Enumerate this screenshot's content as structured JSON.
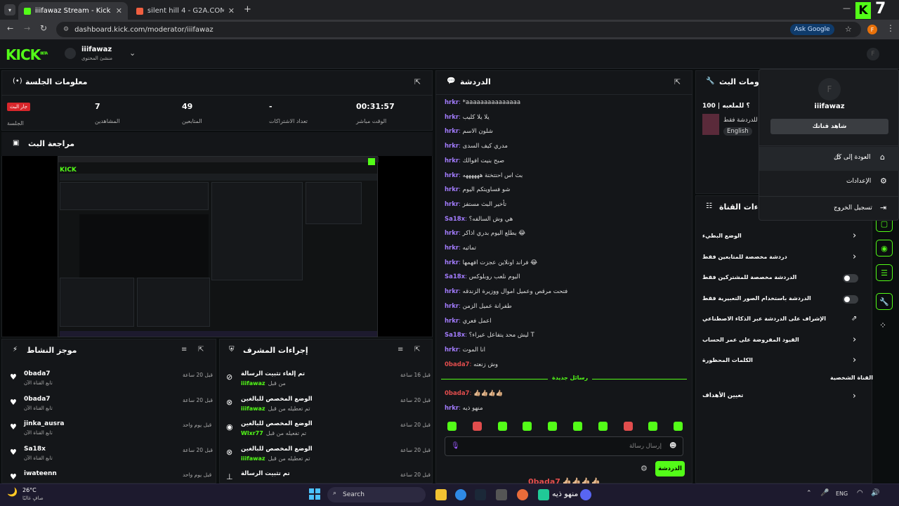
{
  "browser": {
    "tabs": [
      {
        "title": "iiifawaz Stream - Kick Dashboard",
        "active": true
      },
      {
        "title": "silent hill 4 - G2A.COM",
        "active": false
      }
    ],
    "url": "dashboard.kick.com/moderator/iiifawaz",
    "ask_label": "Ask Google",
    "profile_initial": "F"
  },
  "header": {
    "logo": "KICK",
    "logo_tag": "BETA",
    "channel_name": "iiifawaz",
    "channel_role": "منشئ المحتوى",
    "corner_logo": "K 7"
  },
  "session": {
    "title": "معلومات الجلسة",
    "live_badge": "جار البث",
    "session_label": "الجلسة",
    "stats": [
      {
        "value": "00:31:57",
        "label": "الوقت مباشر"
      },
      {
        "value": "-",
        "label": "تعداد الاشتراكات"
      },
      {
        "value": "49",
        "label": "المتابعين"
      },
      {
        "value": "7",
        "label": "المشاهدين"
      }
    ]
  },
  "preview": {
    "title": "مراجعة البث"
  },
  "chat": {
    "title": "الدردشة",
    "messages": [
      {
        "user": "hrkr",
        "text": "*aaaaaaaaaaaaaaa",
        "color": "#a37cff"
      },
      {
        "user": "hrkr",
        "text": "يلا يلا كليب",
        "color": "#a37cff"
      },
      {
        "user": "hrkr",
        "text": "شلون الاسم",
        "color": "#a37cff"
      },
      {
        "user": "hrkr",
        "text": "مدري كيف السدى",
        "color": "#a37cff"
      },
      {
        "user": "hrkr",
        "text": "صبح بنيت افوالك",
        "color": "#a37cff"
      },
      {
        "user": "hrkr",
        "text": "بث اس احتتختة ههههههه",
        "color": "#a37cff"
      },
      {
        "user": "hrkr",
        "text": "شو فساويتكم اليوم",
        "color": "#a37cff"
      },
      {
        "user": "hrkr",
        "text": "تأخير البث مستفز",
        "color": "#a37cff"
      },
      {
        "user": "Sa18x",
        "text": "هي وش السالفه؟",
        "color": "#a37cff"
      },
      {
        "user": "hrkr",
        "text": "يطلع اليوم بدري اذاكر 😂",
        "color": "#a37cff"
      },
      {
        "user": "hrkr",
        "text": "تماثيه",
        "color": "#a37cff"
      },
      {
        "user": "hrkr",
        "text": "فراند اونلاين عجزت افهمها 😂",
        "color": "#a37cff"
      },
      {
        "user": "Sa18x",
        "text": "اليوم نلعب روبلوكس",
        "color": "#a37cff"
      },
      {
        "user": "hrkr",
        "text": "فتحت مرقص وعميل اموال ووزيرة الزندقه",
        "color": "#a37cff"
      },
      {
        "user": "hrkr",
        "text": "طفرانة عميل الزمن",
        "color": "#a37cff"
      },
      {
        "user": "hrkr",
        "text": "اعمل فعري",
        "color": "#a37cff"
      },
      {
        "user": "Sa18x",
        "text": "ليش محد يتفاعل عيراء؟ T",
        "color": "#a37cff"
      },
      {
        "user": "hrkr",
        "text": "انا الموت",
        "color": "#a37cff"
      },
      {
        "user": "0bada7",
        "text": "وش زنعته",
        "color": "#e14d4d"
      }
    ],
    "new_messages": "رسائل جديدة",
    "after": [
      {
        "user": "0bada7",
        "text": "👍🏼👍🏼👍🏼👍🏼",
        "color": "#e14d4d"
      },
      {
        "user": "hrkr",
        "text": "منهو ذيه",
        "color": "#a37cff"
      }
    ],
    "input_placeholder": "إرسال رسالة",
    "send_label": "الدردشة",
    "overlay_user": "0bada7",
    "overlay_text": "👍🏼👍🏼👍🏼👍🏼",
    "overlay_bottom": "منهو ذيه"
  },
  "activity": {
    "title": "موجز النشاط",
    "items": [
      {
        "name": "0bada7",
        "sub": "تابع القناة الآن",
        "time": "قبل 20 ساعة"
      },
      {
        "name": "0bada7",
        "sub": "تابع القناة الآن",
        "time": "قبل 20 ساعة"
      },
      {
        "name": "jinka_ausra",
        "sub": "تابع القناة الآن",
        "time": "قبل يوم واحد"
      },
      {
        "name": "Sa18x",
        "sub": "تابع القناة الآن",
        "time": "قبل 20 ساعة"
      },
      {
        "name": "iwateenn",
        "sub": "",
        "time": "قبل يوم واحد"
      }
    ]
  },
  "modactions": {
    "title": "إجراءات المشرف",
    "items": [
      {
        "action": "تم إلغاء تثبيت الرسالة",
        "by_prefix": "من قبل",
        "by": "iiifawaz",
        "time": "قبل 16 ساعة",
        "icon": "unpin-icon"
      },
      {
        "action": "الوضع المخصص للبالغين",
        "by_prefix": "تم تعطيله من قبل",
        "by": "iiifawaz",
        "time": "قبل 20 ساعة",
        "icon": "eye-off-icon"
      },
      {
        "action": "الوضع المخصص للبالغين",
        "by_prefix": "تم تفعيله من قبل",
        "by": "Wlxr77",
        "time": "قبل 20 ساعة",
        "icon": "eye-icon"
      },
      {
        "action": "الوضع المخصص للبالغين",
        "by_prefix": "تم تعطيله من قبل",
        "by": "iiifawaz",
        "time": "قبل 20 ساعة",
        "icon": "eye-off-icon"
      },
      {
        "action": "تم تثبيت الرسالة",
        "by_prefix": "",
        "by": "",
        "time": "قبل 20 ساعة",
        "icon": "pin-icon"
      }
    ]
  },
  "streaminfo": {
    "title": "معلومات البث",
    "stream_title": "100 | ؟ للملعبه",
    "desc": "مسة للدردشة فقط",
    "tags": [
      "English"
    ]
  },
  "channel_actions": {
    "title": "إجراءات القناة",
    "rows": [
      {
        "label": "الوضع البطيء",
        "control": "chevron"
      },
      {
        "label": "دردشة مخصصة للمتابعين فقط",
        "control": "chevron"
      },
      {
        "label": "الدردشة مخصصة للمشتركين فقط",
        "control": "toggle"
      },
      {
        "label": "الدردشة باستخدام الصور التعبيرية فقط",
        "control": "toggle"
      },
      {
        "label": "الإشراف على الدردشة عبر الذكاء الاصطناعي",
        "control": "external"
      },
      {
        "label": "القيود المفروضة على عمر الحساب",
        "control": "chevron"
      },
      {
        "label": "الكلمات المحظورة",
        "control": "chevron"
      }
    ],
    "section": "القناة الشخصية",
    "last_row": "تعيين الأهداف"
  },
  "menu": {
    "avatar_initial": "F",
    "username": "iiifawaz",
    "watch_button": "شاهد قناتك",
    "items": [
      {
        "label": "العودة إلى كل",
        "icon": "home-icon"
      },
      {
        "label": "الإعدادات",
        "icon": "gear-icon"
      },
      {
        "label": "تسجيل الخروج",
        "icon": "logout-icon"
      }
    ]
  },
  "taskbar": {
    "weather_temp": "26°C",
    "weather_desc": "صافٍ غالبًا",
    "search_label": "Search",
    "lang": "ENG"
  }
}
